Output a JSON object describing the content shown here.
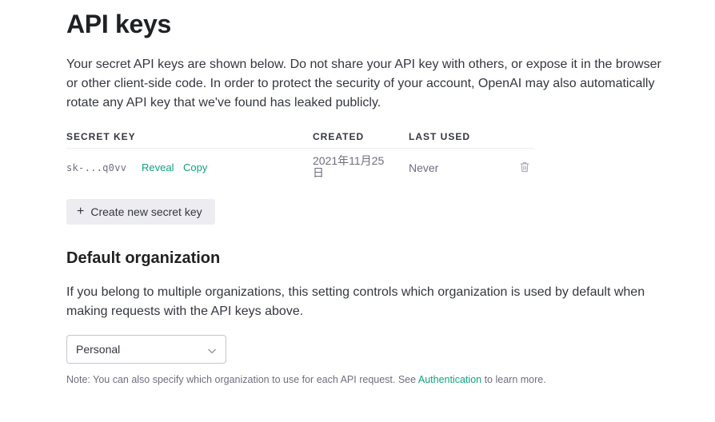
{
  "header": {
    "title": "API keys",
    "intro": "Your secret API keys are shown below. Do not share your API key with others, or expose it in the browser or other client-side code. In order to protect the security of your account, OpenAI may also automatically rotate any API key that we've found has leaked publicly."
  },
  "keys_table": {
    "columns": [
      "SECRET KEY",
      "CREATED",
      "LAST USED"
    ],
    "rows": [
      {
        "key": "sk-...q0vv",
        "reveal_label": "Reveal",
        "copy_label": "Copy",
        "created": "2021年11月25日",
        "last_used": "Never",
        "delete_icon": "trash-icon"
      }
    ]
  },
  "create_button": {
    "icon": "plus-icon",
    "label": "Create new secret key"
  },
  "default_org": {
    "heading": "Default organization",
    "description": "If you belong to multiple organizations, this setting controls which organization is used by default when making requests with the API keys above.",
    "selected": "Personal",
    "chevron_icon": "chevron-down-icon"
  },
  "note": {
    "prefix": "Note: You can also specify which organization to use for each API request. See ",
    "link_label": "Authentication",
    "suffix": " to learn more."
  },
  "colors": {
    "accent": "#10a37f",
    "button_bg": "#ececf1",
    "text": "#353740",
    "muted": "#6e6e80"
  }
}
